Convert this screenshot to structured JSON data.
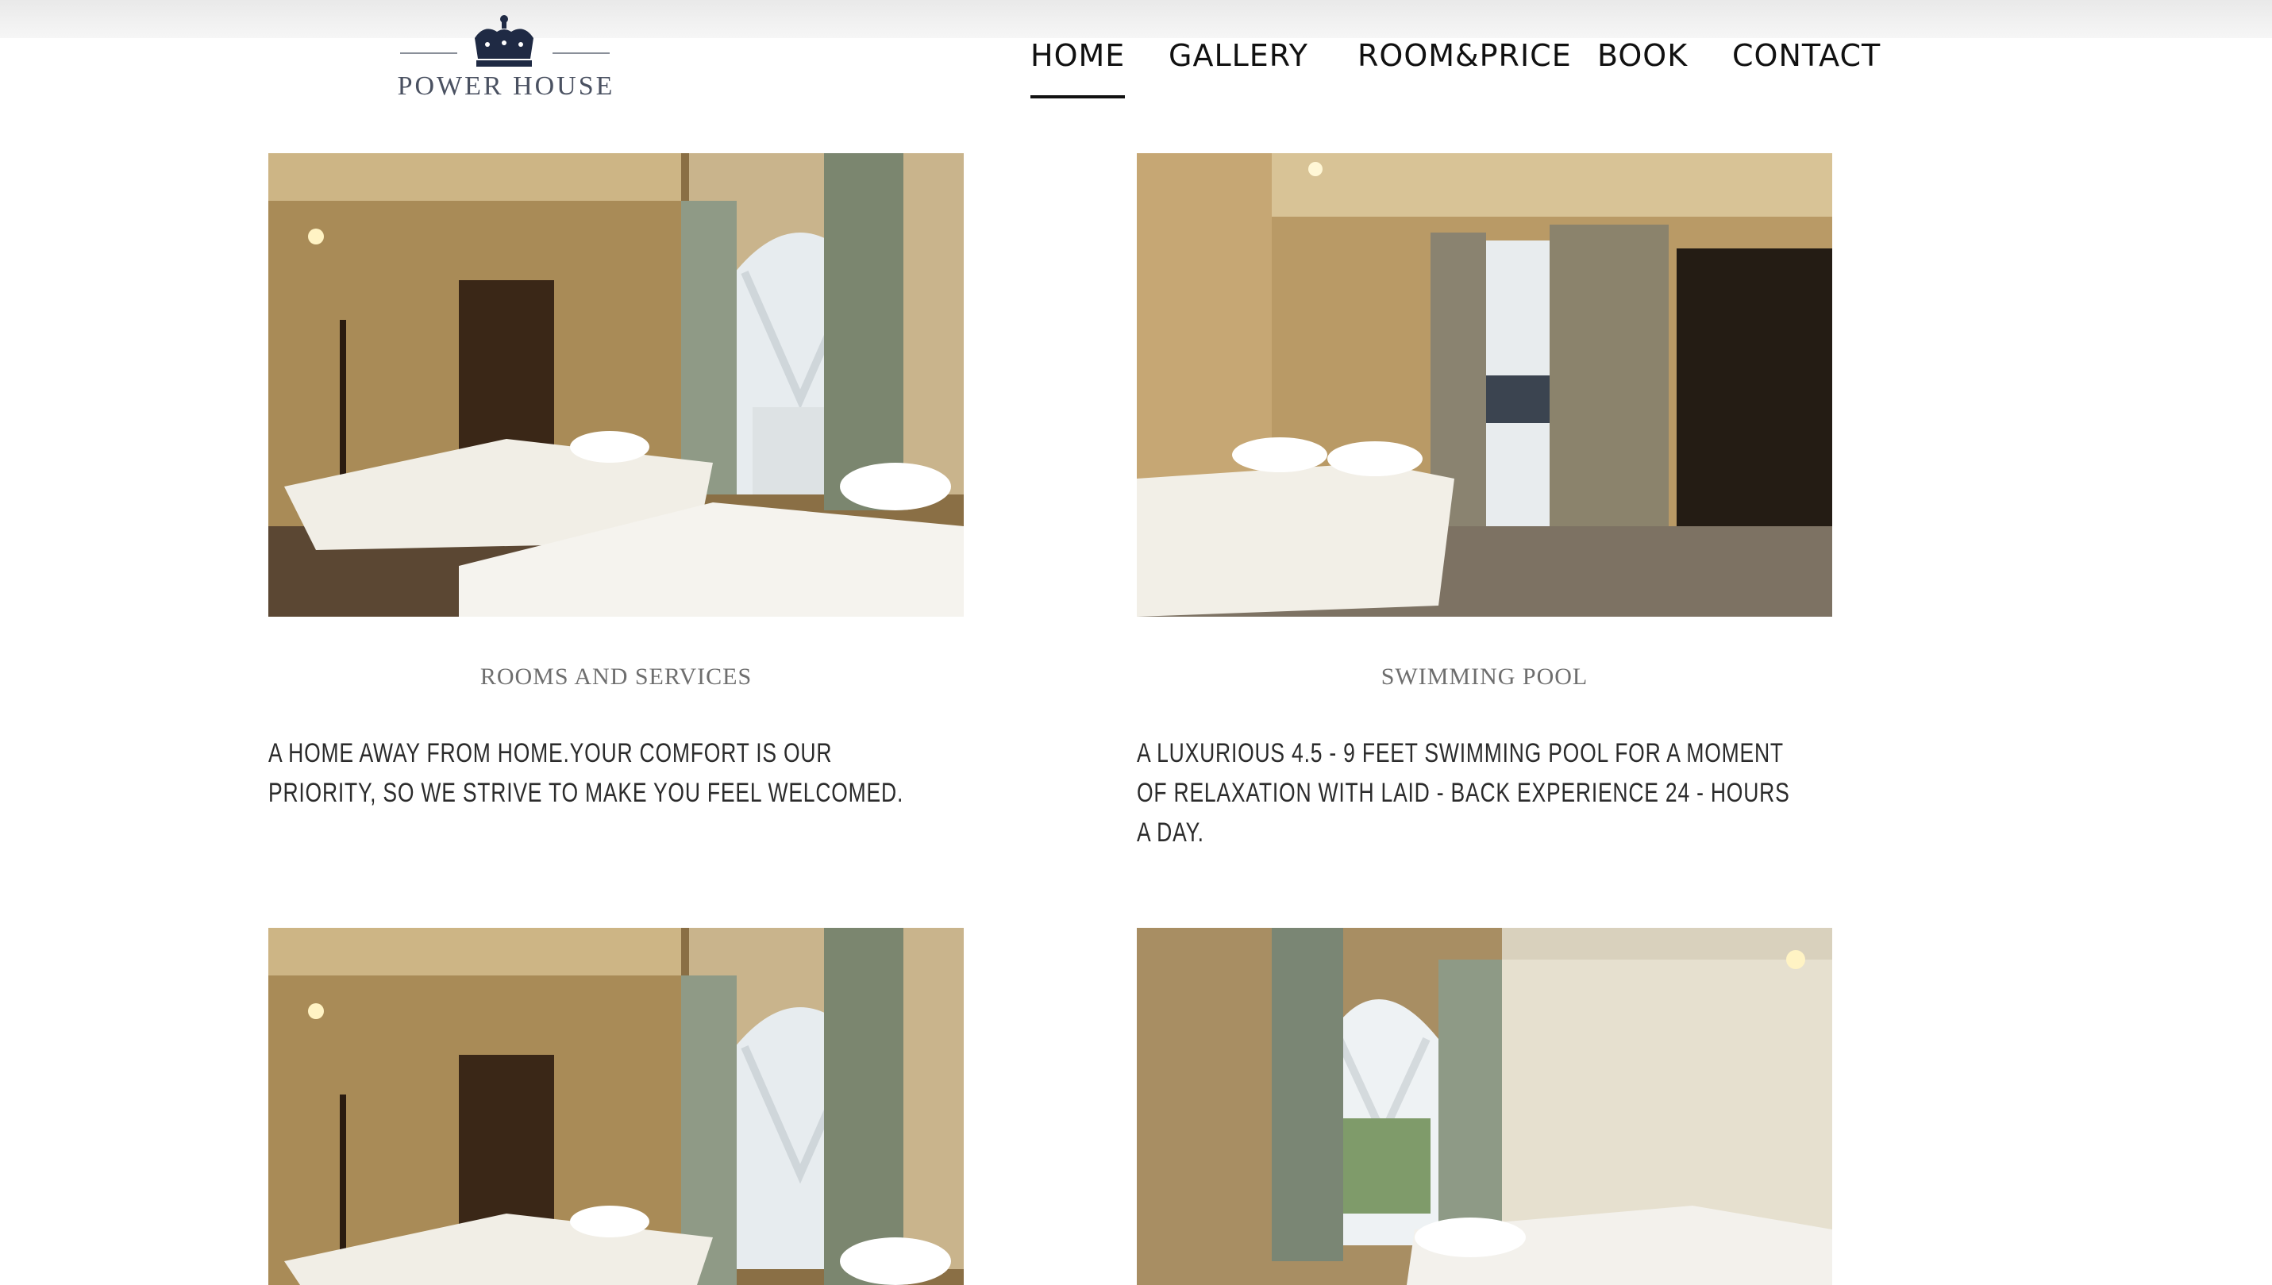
{
  "brand": {
    "name": "POWER HOUSE",
    "logo_icon": "crown-icon"
  },
  "nav": {
    "items": [
      {
        "label": "HOME",
        "active": true
      },
      {
        "label": "GALLERY",
        "active": false
      },
      {
        "label": "ROOM&PRICE",
        "active": false
      },
      {
        "label": "BOOK",
        "active": false
      },
      {
        "label": "CONTACT",
        "active": false
      }
    ]
  },
  "cards": [
    {
      "title": "ROOMS AND SERVICES",
      "text": "A HOME AWAY FROM HOME.YOUR COMFORT IS OUR PRIORITY, SO WE STRIVE TO MAKE YOU FEEL WELCOMED."
    },
    {
      "title": "SWIMMING POOL",
      "text": "A LUXURIOUS 4.5 - 9 FEET SWIMMING POOL FOR A MOMENT OF RELAXATION WITH LAID - BACK EXPERIENCE 24 - HOURS A DAY."
    }
  ],
  "colors": {
    "nav_text": "#111111",
    "caption_title": "#6e6e6e",
    "caption_text": "#2b2b2b",
    "logo_navy": "#1f2a44"
  }
}
